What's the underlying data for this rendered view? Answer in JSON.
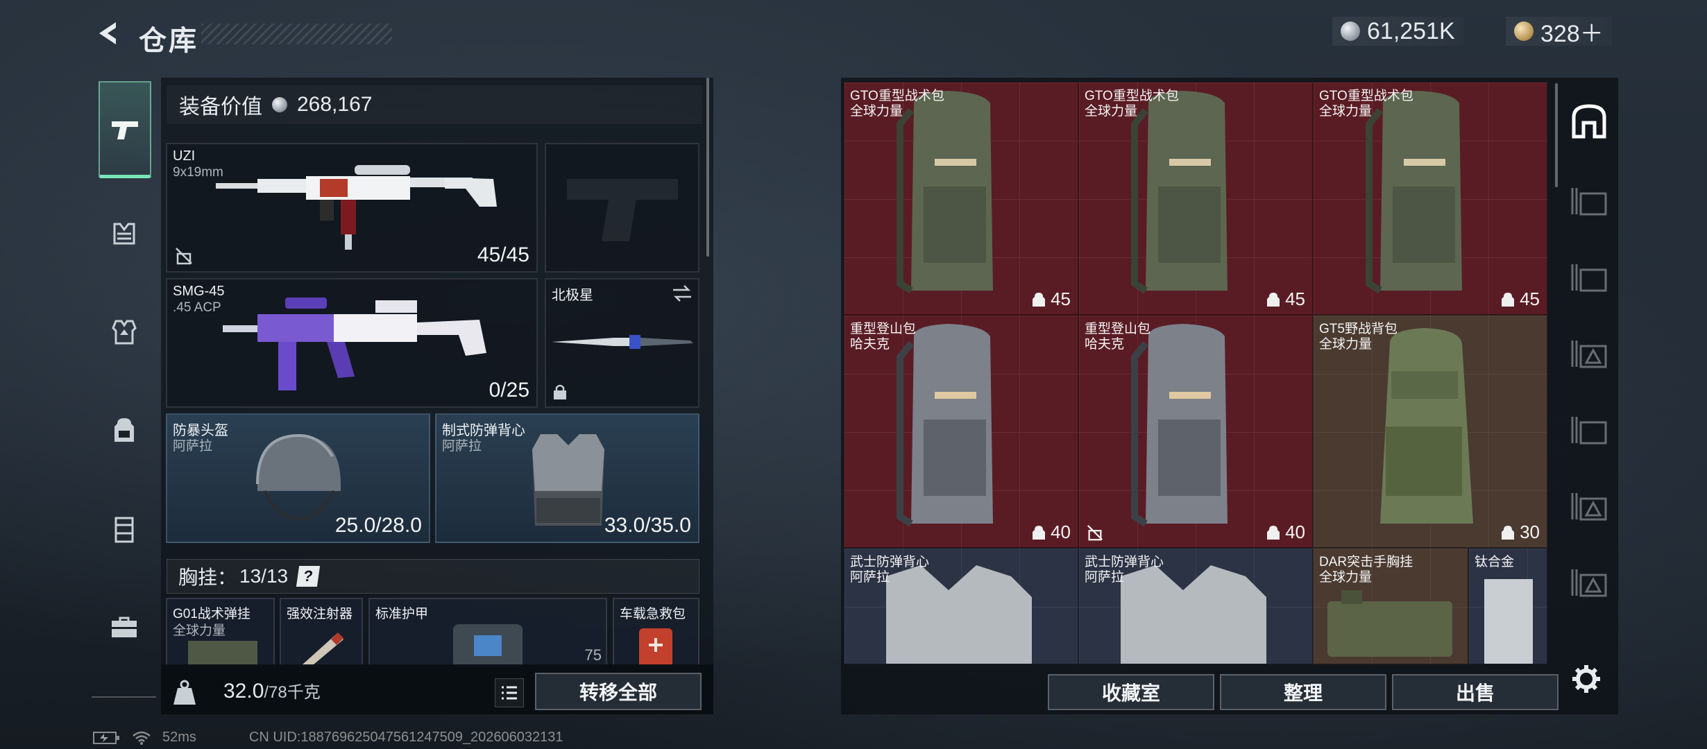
{
  "header": {
    "title": "仓库"
  },
  "currency": {
    "silver": "61,251K",
    "gold": "328＋"
  },
  "left_nav": [
    "pistol-icon",
    "chest-rig-icon",
    "armor-vest-icon",
    "backpack-icon",
    "case-icon",
    "toolbox-icon"
  ],
  "equipment": {
    "label": "装备价值",
    "value": "268,167"
  },
  "weapons": [
    {
      "name": "UZI",
      "caliber": "9x19mm",
      "ammo": "45/45"
    },
    {
      "name": "SMG-45",
      "caliber": ".45 ACP",
      "ammo": "0/25"
    }
  ],
  "knife": {
    "name": "北极星"
  },
  "helmet": {
    "name": "防暴头盔",
    "brand": "阿萨拉",
    "durability": "25.0/28.0"
  },
  "vest": {
    "name": "制式防弹背心",
    "brand": "阿萨拉",
    "durability": "33.0/35.0"
  },
  "chest_rig": {
    "label": "胸挂：",
    "count": "13/13",
    "help": "?"
  },
  "rig_items": [
    {
      "name": "G01战术弹挂",
      "sub": "全球力量"
    },
    {
      "name": "强效注射器"
    },
    {
      "name": "标准护甲",
      "value": "75"
    },
    {
      "name": "车载急救包"
    }
  ],
  "weight": {
    "current": "32.0",
    "max": "/78千克"
  },
  "buttons": {
    "transfer_all": "转移全部",
    "collection": "收藏室",
    "sort": "整理",
    "sell": "出售"
  },
  "storage": [
    {
      "name": "GTO重型战术包",
      "brand": "全球力量",
      "capacity": "45",
      "tier": "red"
    },
    {
      "name": "GTO重型战术包",
      "brand": "全球力量",
      "capacity": "45",
      "tier": "red"
    },
    {
      "name": "GTO重型战术包",
      "brand": "全球力量",
      "capacity": "45",
      "tier": "red"
    },
    {
      "name": "重型登山包",
      "brand": "哈夫克",
      "capacity": "40",
      "tier": "red"
    },
    {
      "name": "重型登山包",
      "brand": "哈夫克",
      "capacity": "40",
      "tier": "red"
    },
    {
      "name": "GT5野战背包",
      "brand": "全球力量",
      "capacity": "30",
      "tier": "brown"
    },
    {
      "name": "武士防弹背心",
      "brand": "阿萨拉",
      "tier": "slate"
    },
    {
      "name": "武士防弹背心",
      "brand": "阿萨拉",
      "tier": "slate"
    },
    {
      "name": "DAR突击手胸挂",
      "brand": "全球力量",
      "tier": "brown"
    },
    {
      "name": "钛合金",
      "tier": "slate"
    }
  ],
  "status": {
    "ping": "52ms",
    "uid": "CN UID:188769625047561247509_202606032131"
  }
}
